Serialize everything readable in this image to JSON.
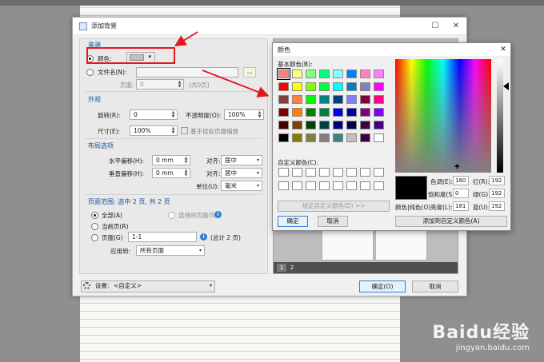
{
  "window": {
    "title": "添加背景"
  },
  "source": {
    "section": "来源",
    "color_label": "颜色:",
    "file_label": "文件名(N):",
    "page_label": "页面:",
    "page_value": "0",
    "page_total": "(共0页)"
  },
  "appearance": {
    "section": "外观",
    "rotate_label": "旋转(R):",
    "rotate_value": "0",
    "opacity_label": "不透明度(O):",
    "opacity_value": "100%",
    "size_label": "尺寸(E):",
    "size_value": "100%",
    "scale_label": "基于目标页面缩放"
  },
  "layout": {
    "section": "布局选项",
    "h_offset_label": "水平偏移(H):",
    "h_offset_value": "0 mm",
    "v_offset_label": "垂直偏移(H):",
    "v_offset_value": "0 mm",
    "align_label": "对齐:",
    "h_align_value": "居中",
    "v_align_value": "居中",
    "unit_label": "单位(U):",
    "unit_value": "毫米"
  },
  "page_range": {
    "section": "页面范围: 选中 2 页, 共 2 页",
    "all_label": "全部(A)",
    "selected_label": "选择的页面(S)",
    "current_label": "当前页(R)",
    "pages_label": "页面(G)",
    "pages_value": "1-1",
    "pages_total": "(总计 2 页)",
    "apply_label": "应用到:",
    "apply_value": "所有页面"
  },
  "footer": {
    "settings_label": "设置:",
    "settings_value": "<自定义>",
    "ok_label": "确定(O)",
    "cancel_label": "取消"
  },
  "preview": {
    "pages": [
      "1",
      "2"
    ]
  },
  "color_dialog": {
    "title": "颜色",
    "basic_label": "基本颜色(B):",
    "custom_label": "自定义颜色(C):",
    "define_label": "规定自定义颜色(D) >>",
    "ok_label": "确定",
    "cancel_label": "取消",
    "hue_label": "色调(E):",
    "hue_value": "160",
    "sat_label": "饱和度(S):",
    "sat_value": "0",
    "lum_label": "亮度(L):",
    "lum_value": "181",
    "red_label": "红(R):",
    "red_value": "192",
    "green_label": "绿(G):",
    "green_value": "192",
    "blue_label": "蓝(U):",
    "blue_value": "192",
    "solid_label": "颜色|纯色(O)",
    "add_label": "添加到自定义颜色(A)",
    "basic_colors": [
      "#ff8080",
      "#ffff80",
      "#80ff80",
      "#00ff80",
      "#80ffff",
      "#0080ff",
      "#ff80c0",
      "#ff80ff",
      "#ff0000",
      "#ffff00",
      "#80ff00",
      "#00ff40",
      "#00ffff",
      "#0080c0",
      "#8080c0",
      "#ff00ff",
      "#804040",
      "#ff8040",
      "#00ff00",
      "#008080",
      "#004080",
      "#8080ff",
      "#800040",
      "#ff0080",
      "#800000",
      "#ff8000",
      "#008000",
      "#008040",
      "#0000ff",
      "#0000a0",
      "#800080",
      "#8000ff",
      "#400000",
      "#804000",
      "#004000",
      "#004040",
      "#000080",
      "#000040",
      "#400040",
      "#400080",
      "#000000",
      "#808000",
      "#808040",
      "#808080",
      "#408080",
      "#c0c0c0",
      "#400040",
      "#ffffff"
    ]
  },
  "watermark": {
    "brand": "Baidu经验",
    "url": "jingyan.baidu.com"
  },
  "colors": {
    "accent": "#1c4f9c",
    "highlight": "#e5161f"
  }
}
